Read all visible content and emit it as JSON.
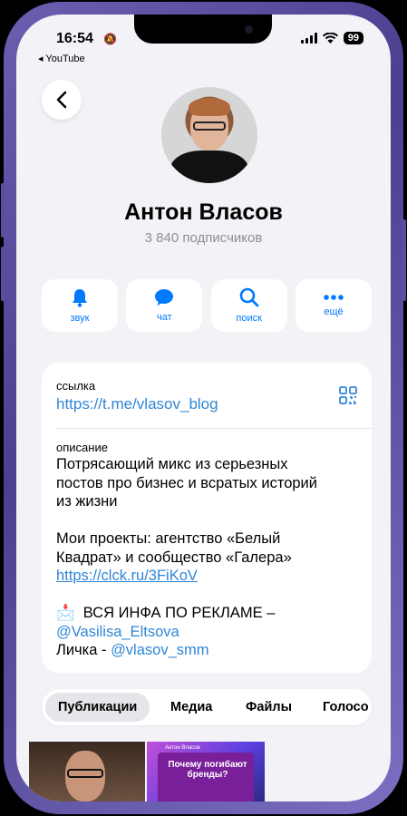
{
  "status_bar": {
    "time": "16:54",
    "battery": "99",
    "back_app": "◂ YouTube"
  },
  "profile": {
    "name": "Антон Власов",
    "subscribers": "3 840 подписчиков"
  },
  "actions": [
    {
      "label": "звук",
      "icon": "bell-icon"
    },
    {
      "label": "чат",
      "icon": "chat-bubble-icon"
    },
    {
      "label": "поиск",
      "icon": "search-icon"
    },
    {
      "label": "ещё",
      "icon": "more-icon"
    }
  ],
  "info": {
    "link_caption": "ссылка",
    "link": "https://t.me/vlasov_blog",
    "description_caption": "описание",
    "description": {
      "line1": "Потрясающий микс из серьезных",
      "line2": "постов про бизнес и всратых историй",
      "line3": "из жизни",
      "line4": "Мои проекты: агентство «Белый",
      "line5": "Квадрат» и сообщество «Галера»",
      "projects_link": "https://clck.ru/3FiKoV",
      "ads_emoji": "📩",
      "ads_text": "ВСЯ ИНФА ПО РЕКЛАМЕ –",
      "ads_link": "@Vasilisa_Eltsova",
      "personal_prefix": "Личка - ",
      "personal_link": "@vlasov_smm"
    }
  },
  "tabs": [
    "Публикации",
    "Медиа",
    "Файлы",
    "Голосо"
  ],
  "media": {
    "thumb2_small": "Антон Власов",
    "thumb2_title": "Почему погибают бренды?"
  },
  "colors": {
    "accent": "#007aff",
    "link": "#2f86d6",
    "background": "#f2f2f7"
  }
}
